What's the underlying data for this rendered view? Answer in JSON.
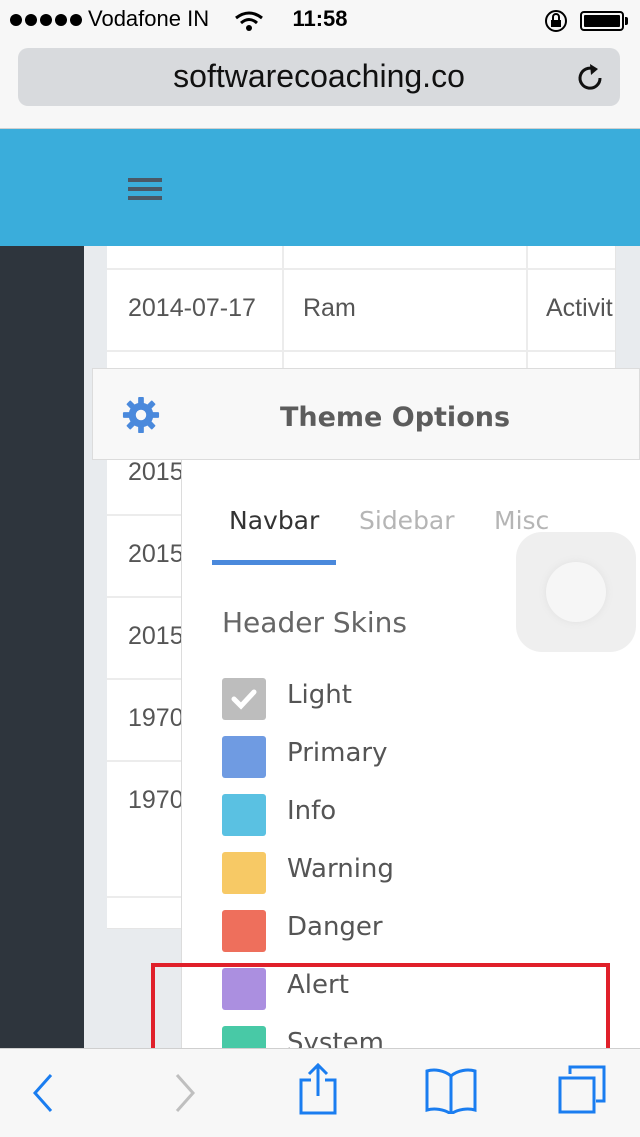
{
  "status_bar": {
    "carrier": "Vodafone IN",
    "time": "11:58"
  },
  "browser": {
    "url": "softwarecoaching.co"
  },
  "table": {
    "rows": [
      {
        "date": "2014-07-17",
        "name": "Ram",
        "activity": "Activit"
      },
      {
        "date": "2015"
      },
      {
        "date": "2015"
      },
      {
        "date": "2015"
      },
      {
        "date": "1970"
      },
      {
        "date": "1970"
      }
    ]
  },
  "theme_options": {
    "title": "Theme Options",
    "tabs": [
      {
        "label": "Navbar",
        "active": true
      },
      {
        "label": "Sidebar",
        "active": false
      },
      {
        "label": "Misc",
        "active": false
      }
    ],
    "section_title": "Header Skins",
    "skins": [
      {
        "label": "Light",
        "color": "#bdbdbd",
        "checked": true
      },
      {
        "label": "Primary",
        "color": "#6f9be2",
        "checked": false
      },
      {
        "label": "Info",
        "color": "#5ac1e2",
        "checked": false
      },
      {
        "label": "Warning",
        "color": "#f7c965",
        "checked": false
      },
      {
        "label": "Danger",
        "color": "#ee6f5c",
        "checked": false
      },
      {
        "label": "Alert",
        "color": "#ab8fe0",
        "checked": false
      },
      {
        "label": "System",
        "color": "#48c9a6",
        "checked": false
      }
    ]
  },
  "colors": {
    "header_bg": "#3aaddb",
    "sidebar_bg": "#2e353d",
    "accent_blue": "#4a89dc",
    "ios_blue": "#1a7df0",
    "highlight_red": "#e0202a"
  },
  "icons": {
    "menu": "hamburger-icon",
    "settings": "gear-icon",
    "reload": "reload-icon",
    "back": "back-chevron-icon",
    "forward": "forward-chevron-icon",
    "share": "share-icon",
    "bookmarks": "book-icon",
    "tabs": "tabs-icon"
  }
}
